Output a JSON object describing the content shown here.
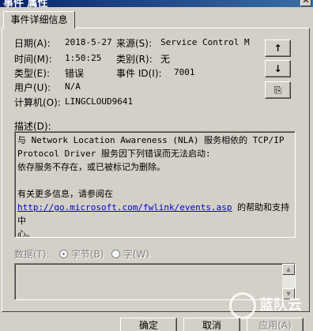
{
  "window": {
    "title": "事件 属性",
    "close_glyph": "✕"
  },
  "tab": {
    "label": "事件详细信息"
  },
  "fields": {
    "date_label": "日期(A):",
    "date_value": "2018-5-27",
    "source_label": "来源(S):",
    "source_value": "Service Control M",
    "time_label": "时间(M):",
    "time_value": "1:50:25",
    "category_label": "类别(R):",
    "category_value": "无",
    "type_label": "类型(E):",
    "type_value": "错误",
    "eventid_label": "事件 ID(I):",
    "eventid_value": "7001",
    "user_label": "用户(U):",
    "user_value": "N/A",
    "computer_label": "计算机(O):",
    "computer_value": "LINGCLOUD9641"
  },
  "side_buttons": {
    "up": "↑",
    "down": "↓",
    "copy": "⎘"
  },
  "description": {
    "label": "描述(D):",
    "line1": "与 Network Location Awareness (NLA) 服务相依的 TCP/IP",
    "line2": "Protocol Driver 服务因下列错误而无法启动:",
    "line3": "依存服务不存在，或已被标记为删除。",
    "line4": "有关更多信息，请参阅在",
    "link": "http://go.microsoft.com/fwlink/events.asp",
    "line5_suffix": " 的帮助和支持中",
    "line6": "心。"
  },
  "data_section": {
    "label": "数据(T):",
    "bytes_label": "字节(B)",
    "words_label": "字(W)"
  },
  "scroll": {
    "up": "▲",
    "down": "▼"
  },
  "buttons": {
    "ok": "确定",
    "cancel": "取消",
    "apply": "应用(A)"
  },
  "watermark": {
    "text": "蓝队云"
  }
}
